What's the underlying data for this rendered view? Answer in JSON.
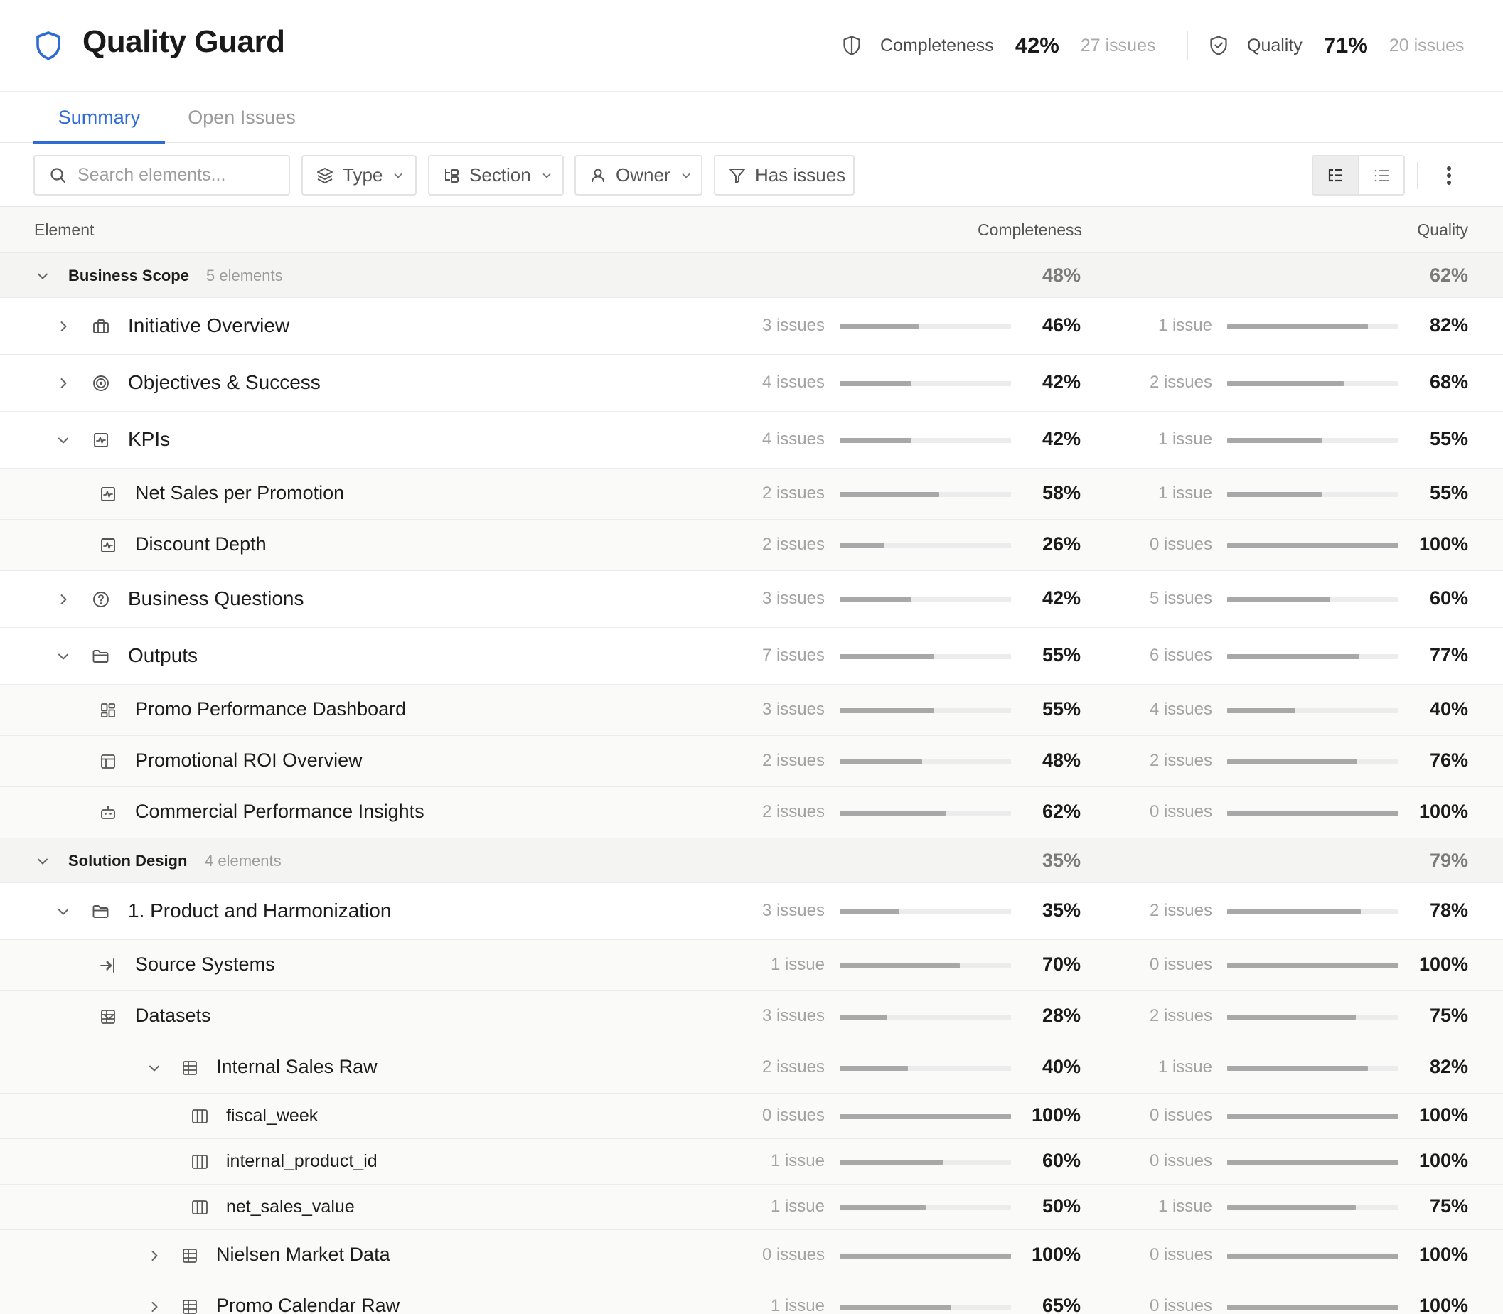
{
  "header": {
    "title": "Quality Guard",
    "completeness": {
      "label": "Completeness",
      "value": "42%",
      "issues": "27 issues"
    },
    "quality": {
      "label": "Quality",
      "value": "71%",
      "issues": "20 issues"
    }
  },
  "tabs": [
    {
      "label": "Summary",
      "active": true
    },
    {
      "label": "Open Issues",
      "active": false
    }
  ],
  "toolbar": {
    "search_placeholder": "Search elements...",
    "filters": [
      "Type",
      "Section",
      "Owner",
      "Has issues"
    ],
    "view_mode": "tree"
  },
  "table": {
    "columns": {
      "element": "Element",
      "completeness": "Completeness",
      "quality": "Quality"
    },
    "rows": [
      {
        "kind": "group",
        "name": "Business Scope",
        "count": "5 elements",
        "expanded": true,
        "c_pct": "48%",
        "q_pct": "62%"
      },
      {
        "kind": "item",
        "level": 1,
        "chevron": "right",
        "icon": "briefcase-icon",
        "name": "Initiative Overview",
        "c_issues": "3 issues",
        "c_fill": 0.46,
        "c_pct": "46%",
        "q_issues": "1 issue",
        "q_fill": 0.82,
        "q_pct": "82%"
      },
      {
        "kind": "item",
        "level": 1,
        "chevron": "right",
        "icon": "target-icon",
        "name": "Objectives & Success",
        "c_issues": "4 issues",
        "c_fill": 0.42,
        "c_pct": "42%",
        "q_issues": "2 issues",
        "q_fill": 0.68,
        "q_pct": "68%"
      },
      {
        "kind": "item",
        "level": 1,
        "chevron": "down",
        "icon": "kpi-icon",
        "name": "KPIs",
        "c_issues": "4 issues",
        "c_fill": 0.42,
        "c_pct": "42%",
        "q_issues": "1 issue",
        "q_fill": 0.55,
        "q_pct": "55%"
      },
      {
        "kind": "sub",
        "level": 2,
        "chevron": null,
        "icon": "kpi-icon",
        "name": "Net Sales per Promotion",
        "c_issues": "2 issues",
        "c_fill": 0.58,
        "c_pct": "58%",
        "q_issues": "1 issue",
        "q_fill": 0.55,
        "q_pct": "55%"
      },
      {
        "kind": "sub",
        "level": 2,
        "chevron": null,
        "icon": "kpi-icon",
        "name": "Discount Depth",
        "c_issues": "2 issues",
        "c_fill": 0.26,
        "c_pct": "26%",
        "q_issues": "0 issues",
        "q_fill": 1.0,
        "q_pct": "100%"
      },
      {
        "kind": "item",
        "level": 1,
        "chevron": "right",
        "icon": "question-icon",
        "name": "Business Questions",
        "c_issues": "3 issues",
        "c_fill": 0.42,
        "c_pct": "42%",
        "q_issues": "5 issues",
        "q_fill": 0.6,
        "q_pct": "60%"
      },
      {
        "kind": "item",
        "level": 1,
        "chevron": "down",
        "icon": "folder-icon",
        "name": "Outputs",
        "c_issues": "7 issues",
        "c_fill": 0.55,
        "c_pct": "55%",
        "q_issues": "6 issues",
        "q_fill": 0.77,
        "q_pct": "77%"
      },
      {
        "kind": "sub",
        "level": 2,
        "chevron": null,
        "icon": "dashboard-icon",
        "name": "Promo Performance Dashboard",
        "c_issues": "3 issues",
        "c_fill": 0.55,
        "c_pct": "55%",
        "q_issues": "4 issues",
        "q_fill": 0.4,
        "q_pct": "40%"
      },
      {
        "kind": "sub",
        "level": 2,
        "chevron": null,
        "icon": "layout-icon",
        "name": "Promotional ROI Overview",
        "c_issues": "2 issues",
        "c_fill": 0.48,
        "c_pct": "48%",
        "q_issues": "2 issues",
        "q_fill": 0.76,
        "q_pct": "76%"
      },
      {
        "kind": "sub",
        "level": 2,
        "chevron": null,
        "icon": "bot-icon",
        "name": "Commercial Performance Insights",
        "c_issues": "2 issues",
        "c_fill": 0.62,
        "c_pct": "62%",
        "q_issues": "0 issues",
        "q_fill": 1.0,
        "q_pct": "100%"
      },
      {
        "kind": "group",
        "name": "Solution Design",
        "count": "4 elements",
        "expanded": true,
        "c_pct": "35%",
        "q_pct": "79%"
      },
      {
        "kind": "item",
        "level": 1,
        "chevron": "down",
        "icon": "folder-icon",
        "name": "1. Product and Harmonization",
        "c_issues": "3 issues",
        "c_fill": 0.35,
        "c_pct": "35%",
        "q_issues": "2 issues",
        "q_fill": 0.78,
        "q_pct": "78%"
      },
      {
        "kind": "sub",
        "level": 2,
        "chevron": "right",
        "icon": "source-icon",
        "name": "Source Systems",
        "c_issues": "1 issue",
        "c_fill": 0.7,
        "c_pct": "70%",
        "q_issues": "0 issues",
        "q_fill": 1.0,
        "q_pct": "100%"
      },
      {
        "kind": "sub",
        "level": 2,
        "chevron": "down",
        "icon": "table-icon",
        "name": "Datasets",
        "c_issues": "3 issues",
        "c_fill": 0.28,
        "c_pct": "28%",
        "q_issues": "2 issues",
        "q_fill": 0.75,
        "q_pct": "75%"
      },
      {
        "kind": "sub",
        "level": 3,
        "chevron": "down",
        "icon": "table-icon",
        "name": "Internal Sales Raw",
        "c_issues": "2 issues",
        "c_fill": 0.4,
        "c_pct": "40%",
        "q_issues": "1 issue",
        "q_fill": 0.82,
        "q_pct": "82%"
      },
      {
        "kind": "sub",
        "level": 4,
        "chevron": null,
        "icon": "column-icon",
        "name": "fiscal_week",
        "c_issues": "0 issues",
        "c_fill": 1.0,
        "c_pct": "100%",
        "q_issues": "0 issues",
        "q_fill": 1.0,
        "q_pct": "100%"
      },
      {
        "kind": "sub",
        "level": 4,
        "chevron": null,
        "icon": "column-icon",
        "name": "internal_product_id",
        "c_issues": "1 issue",
        "c_fill": 0.6,
        "c_pct": "60%",
        "q_issues": "0 issues",
        "q_fill": 1.0,
        "q_pct": "100%"
      },
      {
        "kind": "sub",
        "level": 4,
        "chevron": null,
        "icon": "column-icon",
        "name": "net_sales_value",
        "c_issues": "1 issue",
        "c_fill": 0.5,
        "c_pct": "50%",
        "q_issues": "1 issue",
        "q_fill": 0.75,
        "q_pct": "75%"
      },
      {
        "kind": "sub",
        "level": 3,
        "chevron": "right",
        "icon": "table-icon",
        "name": "Nielsen Market Data",
        "c_issues": "0 issues",
        "c_fill": 1.0,
        "c_pct": "100%",
        "q_issues": "0 issues",
        "q_fill": 1.0,
        "q_pct": "100%"
      },
      {
        "kind": "sub",
        "level": 3,
        "chevron": "right",
        "icon": "table-icon",
        "name": "Promo Calendar Raw",
        "c_issues": "1 issue",
        "c_fill": 0.65,
        "c_pct": "65%",
        "q_issues": "0 issues",
        "q_fill": 1.0,
        "q_pct": "100%"
      }
    ]
  }
}
